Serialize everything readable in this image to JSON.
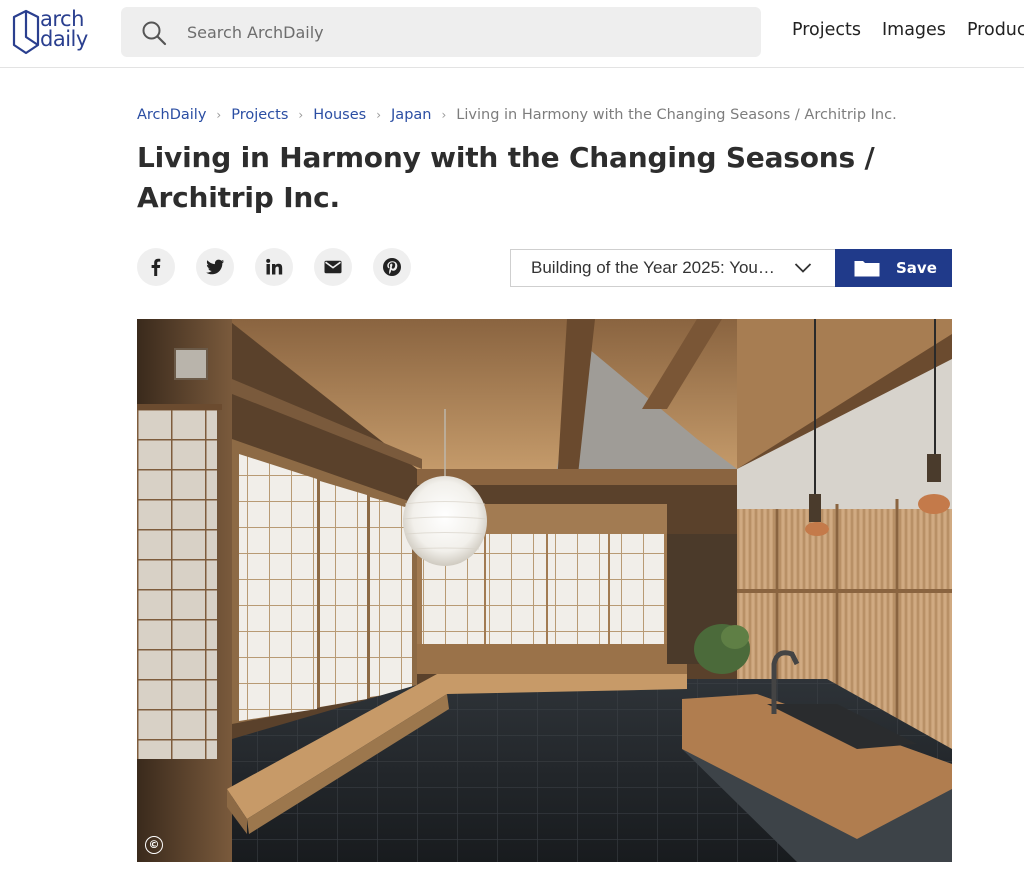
{
  "header": {
    "logo_line1": "arch",
    "logo_line2": "daily",
    "search_placeholder": "Search ArchDaily",
    "nav": [
      "Projects",
      "Images",
      "Products"
    ]
  },
  "breadcrumb": {
    "items": [
      "ArchDaily",
      "Projects",
      "Houses",
      "Japan"
    ],
    "current": "Living in Harmony with the Changing Seasons / Architrip Inc."
  },
  "article": {
    "title": "Living in Harmony with the Changing Seasons / Architrip Inc."
  },
  "share": {
    "icons": [
      "facebook-icon",
      "twitter-icon",
      "linkedin-icon",
      "email-icon",
      "pinterest-icon"
    ]
  },
  "folder_select": {
    "value": "Building of the Year 2025: You…"
  },
  "save": {
    "label": "Save"
  },
  "photo": {
    "copyright_symbol": "©",
    "description_icon": "interior-photo"
  },
  "colors": {
    "brand": "#203a8a",
    "link": "#2b4ea3"
  }
}
